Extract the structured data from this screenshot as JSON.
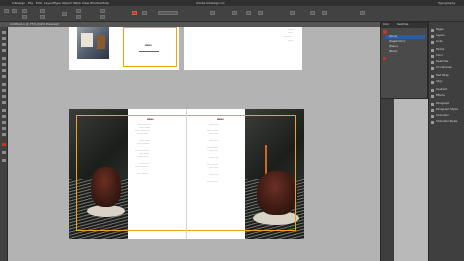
{
  "menubar": {
    "items": [
      "InDesign",
      "File",
      "Edit",
      "Layout",
      "Type",
      "Object",
      "Table",
      "View",
      "Window",
      "Help"
    ],
    "workspace": "Typography"
  },
  "tab": {
    "label": "Untitled-1 @ 75% [GPU Preview]"
  },
  "document_title": "Adobe InDesign CC",
  "spread_top_left_title": "MENU",
  "spread_main": {
    "left_col_heading": "MENU",
    "right_col_heading": "MENU"
  },
  "swatches_panel": {
    "tabs": [
      "Color",
      "Swatches"
    ],
    "rows": [
      "[None]",
      "[Registration]",
      "[Paper]",
      "[Black]"
    ]
  },
  "right_panel": {
    "items": [
      "Pages",
      "Layers",
      "Links",
      "Stroke",
      "Color",
      "Swatches",
      "CC Libraries",
      "Text Wrap",
      "Align",
      "Gradient",
      "Effects",
      "Paragraph",
      "Paragraph Styles",
      "Character",
      "Character Styles"
    ]
  },
  "colors": {
    "accent_red": "#c4371f",
    "frame_orange": "#f2a20f",
    "ui_dark": "#3f3f3f",
    "pasteboard": "#b3b3b3"
  }
}
